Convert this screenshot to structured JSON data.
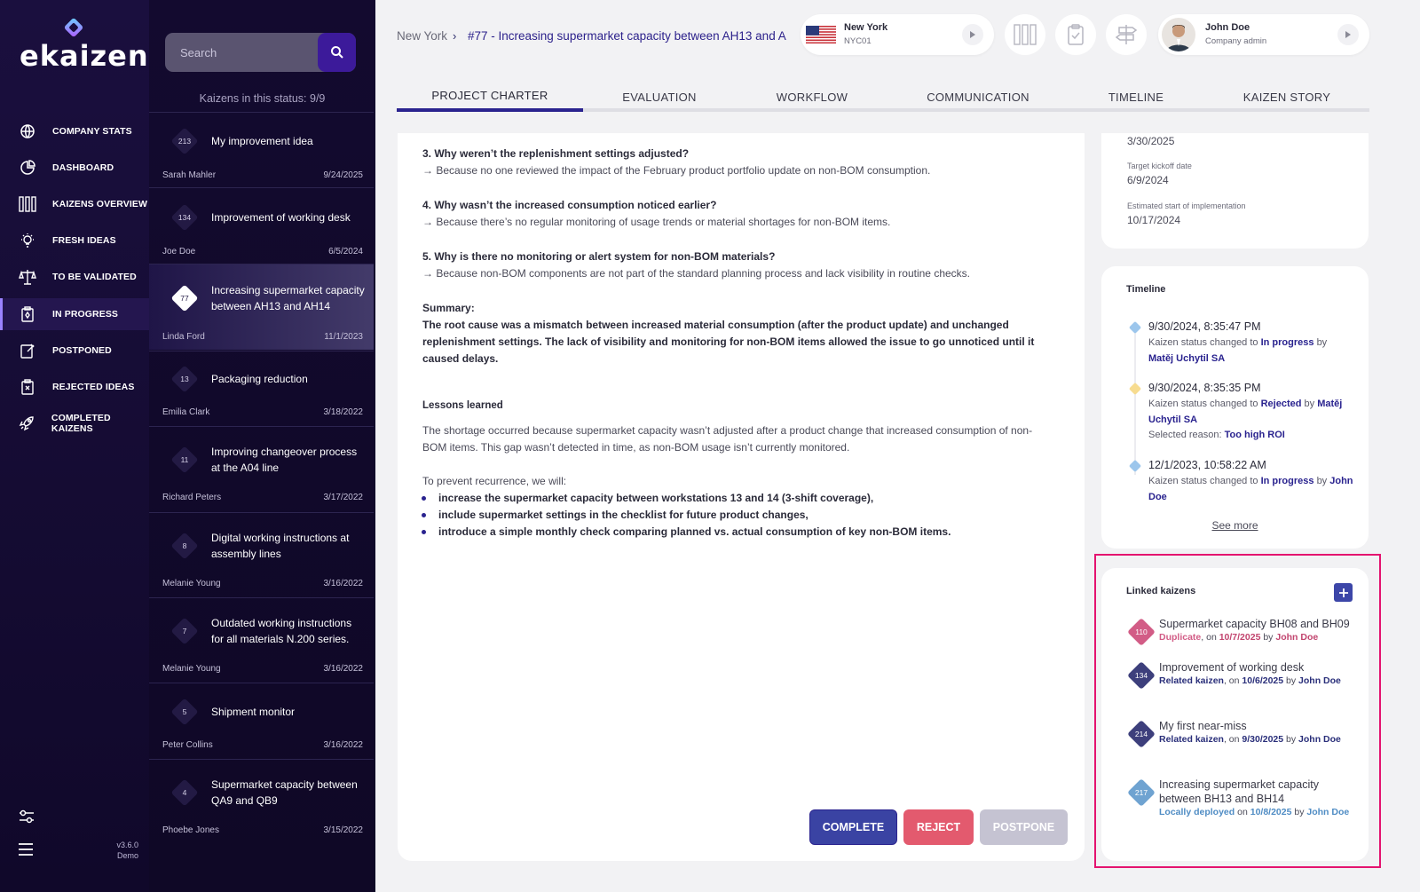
{
  "app": {
    "brand": "ekaizen",
    "version": "v3.6.0",
    "mode": "Demo"
  },
  "colors": {
    "sidebar_bg": "#1a0f3e",
    "accent": "#2a238f",
    "complete": "#3a43a3",
    "reject": "#e35a6e",
    "postpone": "#c5c3d2",
    "highlight": "#e4136f"
  },
  "sidebar": {
    "items": [
      {
        "label": "COMPANY STATS",
        "icon": "globe-icon"
      },
      {
        "label": "DASHBOARD",
        "icon": "pie-chart-icon"
      },
      {
        "label": "KAIZENS OVERVIEW",
        "icon": "columns-icon"
      },
      {
        "label": "FRESH IDEAS",
        "icon": "lightbulb-icon"
      },
      {
        "label": "TO BE VALIDATED",
        "icon": "scales-icon"
      },
      {
        "label": "IN PROGRESS",
        "icon": "clipboard-progress-icon"
      },
      {
        "label": "POSTPONED",
        "icon": "clipboard-edit-icon"
      },
      {
        "label": "REJECTED IDEAS",
        "icon": "clipboard-x-icon"
      },
      {
        "label": "COMPLETED KAIZENS",
        "icon": "rocket-icon"
      }
    ],
    "active_index": 5
  },
  "list": {
    "search_placeholder": "Search",
    "status_count": "Kaizens in this status: 9/9",
    "items": [
      {
        "num": "213",
        "title": "My improvement idea",
        "author": "Sarah Mahler",
        "date": "9/24/2025"
      },
      {
        "num": "134",
        "title": "Improvement of working desk",
        "author": "Joe Doe",
        "date": "6/5/2024"
      },
      {
        "num": "77",
        "title": "Increasing supermarket capacity between AH13 and AH14",
        "author": "Linda Ford",
        "date": "11/1/2023"
      },
      {
        "num": "13",
        "title": "Packaging reduction",
        "author": "Emilia Clark",
        "date": "3/18/2022"
      },
      {
        "num": "11",
        "title": "Improving changeover process at the A04 line",
        "author": "Richard Peters",
        "date": "3/17/2022"
      },
      {
        "num": "8",
        "title": "Digital working instructions at assembly lines",
        "author": "Melanie Young",
        "date": "3/16/2022"
      },
      {
        "num": "7",
        "title": "Outdated working instructions for all materials N.200 series.",
        "author": "Melanie Young",
        "date": "3/16/2022"
      },
      {
        "num": "5",
        "title": "Shipment monitor",
        "author": "Peter Collins",
        "date": "3/16/2022"
      },
      {
        "num": "4",
        "title": "Supermarket capacity between QA9 and QB9",
        "author": "Phoebe Jones",
        "date": "3/15/2022"
      }
    ]
  },
  "header": {
    "breadcrumb_city": "New York",
    "breadcrumb_sep": "›",
    "breadcrumb_title": "#77 - Increasing supermarket capacity between AH13 and A...",
    "location": {
      "name": "New York",
      "code": "NYC01"
    },
    "user": {
      "name": "John Doe",
      "role": "Company admin"
    }
  },
  "tabs": [
    "PROJECT CHARTER",
    "EVALUATION",
    "WORKFLOW",
    "COMMUNICATION",
    "TIMELINE",
    "KAIZEN STORY"
  ],
  "charter": {
    "q3": "3. Why weren’t the replenishment settings adjusted?",
    "a3": "→ Because no one reviewed the impact of the February product portfolio update on non-BOM consumption.",
    "q4": "4. Why wasn’t the increased consumption noticed earlier?",
    "a4": "→ Because there’s no regular monitoring of usage trends or material shortages for non-BOM items.",
    "q5": "5. Why is there no monitoring or alert system for non-BOM materials?",
    "a5": "→ Because non-BOM components are not part of the standard planning process and lack visibility in routine checks.",
    "summary_label": "Summary:",
    "summary_text": "The root cause was a mismatch between increased material consumption (after the product update) and unchanged replenishment settings. The lack of visibility and monitoring for non-BOM items allowed the issue to go unnoticed until it caused delays.",
    "lessons_label": "Lessons learned",
    "lessons_text": "The shortage occurred because supermarket capacity wasn’t adjusted after a product change that increased consumption of non-BOM items. This gap wasn’t detected in time, as non-BOM usage isn’t currently monitored.",
    "prevent_intro": "To prevent recurrence, we will:",
    "bullets": [
      "increase the supermarket capacity between workstations 13 and 14 (3-shift coverage),",
      "include supermarket settings in the checklist for future product changes,",
      "introduce a simple monthly check comparing planned vs. actual consumption of key non-BOM items."
    ]
  },
  "actions": {
    "complete": "COMPLETE",
    "reject": "REJECT",
    "postpone": "POSTPONE"
  },
  "dates": {
    "top_value": "3/30/2025",
    "kickoff_label": "Target kickoff date",
    "kickoff_value": "6/9/2024",
    "impl_label": "Estimated start of implementation",
    "impl_value": "10/17/2024"
  },
  "timeline": {
    "title": "Timeline",
    "see_more": "See more",
    "entries": [
      {
        "time": "9/30/2024, 8:35:47 PM",
        "pre": "Kaizen status changed to",
        "status": "In progress",
        "by": "by",
        "user": "Matěj Uchytil SA",
        "color": "#9cc6ec"
      },
      {
        "time": "9/30/2024, 8:35:35 PM",
        "pre": "Kaizen status changed to",
        "status": "Rejected",
        "by": "by",
        "user": "Matěj Uchytil SA",
        "reason_label": "Selected reason:",
        "reason": "Too high ROI",
        "color": "#f7dc90"
      },
      {
        "time": "12/1/2023, 10:58:22 AM",
        "pre": "Kaizen status changed to",
        "status": "In progress",
        "by": "by",
        "user": "John Doe",
        "color": "#9cc6ec"
      }
    ]
  },
  "linked": {
    "title": "Linked kaizens",
    "items": [
      {
        "num": "110",
        "title": "Supermarket capacity BH08 and BH09",
        "rel": "Duplicate",
        "on": ", on",
        "date": "10/7/2025",
        "by": "by",
        "user": "John Doe",
        "color": "#d25c86"
      },
      {
        "num": "134",
        "title": "Improvement of working desk",
        "rel": "Related kaizen",
        "on": ", on",
        "date": "10/6/2025",
        "by": "by",
        "user": "John Doe",
        "color": "#3d3f7c"
      },
      {
        "num": "214",
        "title": "My first near-miss",
        "rel": "Related kaizen",
        "on": ", on",
        "date": "9/30/2025",
        "by": "by",
        "user": "John Doe",
        "color": "#3d3f7c"
      },
      {
        "num": "217",
        "title": "Increasing supermarket capacity between BH13 and BH14",
        "rel": "Locally deployed",
        "on": "on",
        "date": "10/8/2025",
        "by": "by",
        "user": "John Doe",
        "color": "#6fa3d1"
      }
    ]
  }
}
